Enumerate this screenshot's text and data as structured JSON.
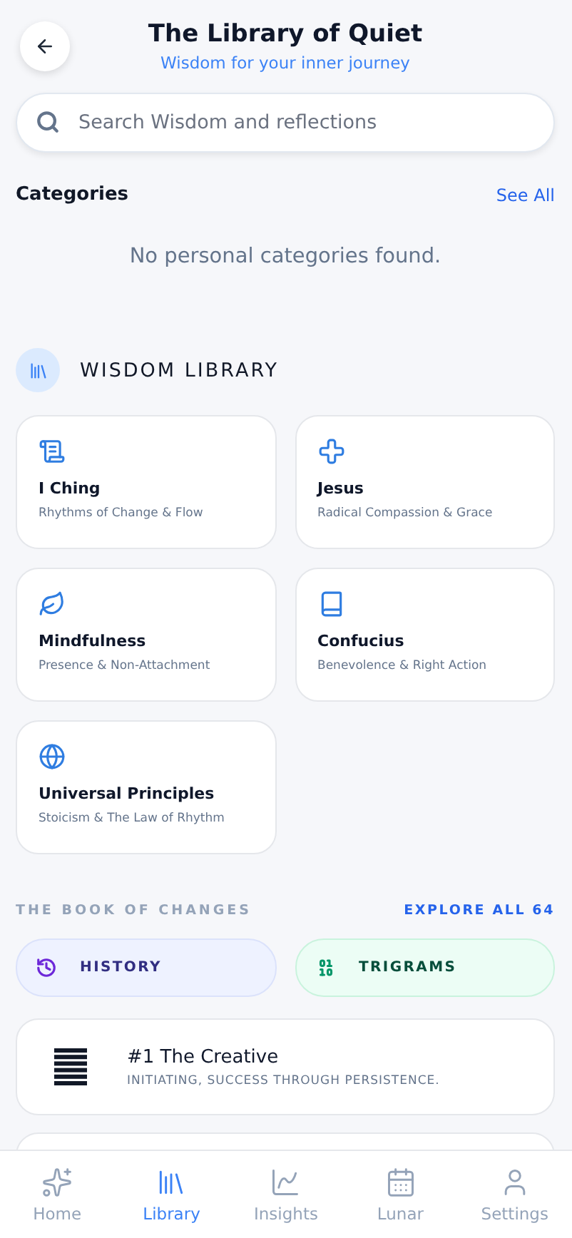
{
  "header": {
    "title": "The Library of Quiet",
    "subtitle": "Wisdom for your inner journey"
  },
  "search": {
    "placeholder": "Search Wisdom and reflections"
  },
  "categories": {
    "title": "Categories",
    "action": "See All",
    "empty": "No personal categories found."
  },
  "wisdom_library": {
    "title": "WISDOM LIBRARY",
    "items": [
      {
        "title": "I Ching",
        "subtitle": "Rhythms of Change & Flow"
      },
      {
        "title": "Jesus",
        "subtitle": "Radical Compassion & Grace"
      },
      {
        "title": "Mindfulness",
        "subtitle": "Presence & Non-Attachment"
      },
      {
        "title": "Confucius",
        "subtitle": "Benevolence & Right Action"
      },
      {
        "title": "Universal Principles",
        "subtitle": "Stoicism & The Law of Rhythm"
      }
    ]
  },
  "book_of_changes": {
    "title": "THE BOOK OF CHANGES",
    "action": "EXPLORE ALL 64",
    "buttons": [
      {
        "kind": "history",
        "label": "HISTORY"
      },
      {
        "kind": "trigrams",
        "label": "TRIGRAMS"
      }
    ],
    "hexagrams": [
      {
        "title": "#1 The Creative",
        "subtitle": "INITIATING, SUCCESS THROUGH PERSISTENCE."
      }
    ]
  },
  "nav": [
    {
      "label": "Home",
      "selected": false
    },
    {
      "label": "Library",
      "selected": true
    },
    {
      "label": "Insights",
      "selected": false
    },
    {
      "label": "Lunar",
      "selected": false
    },
    {
      "label": "Settings",
      "selected": false
    }
  ]
}
